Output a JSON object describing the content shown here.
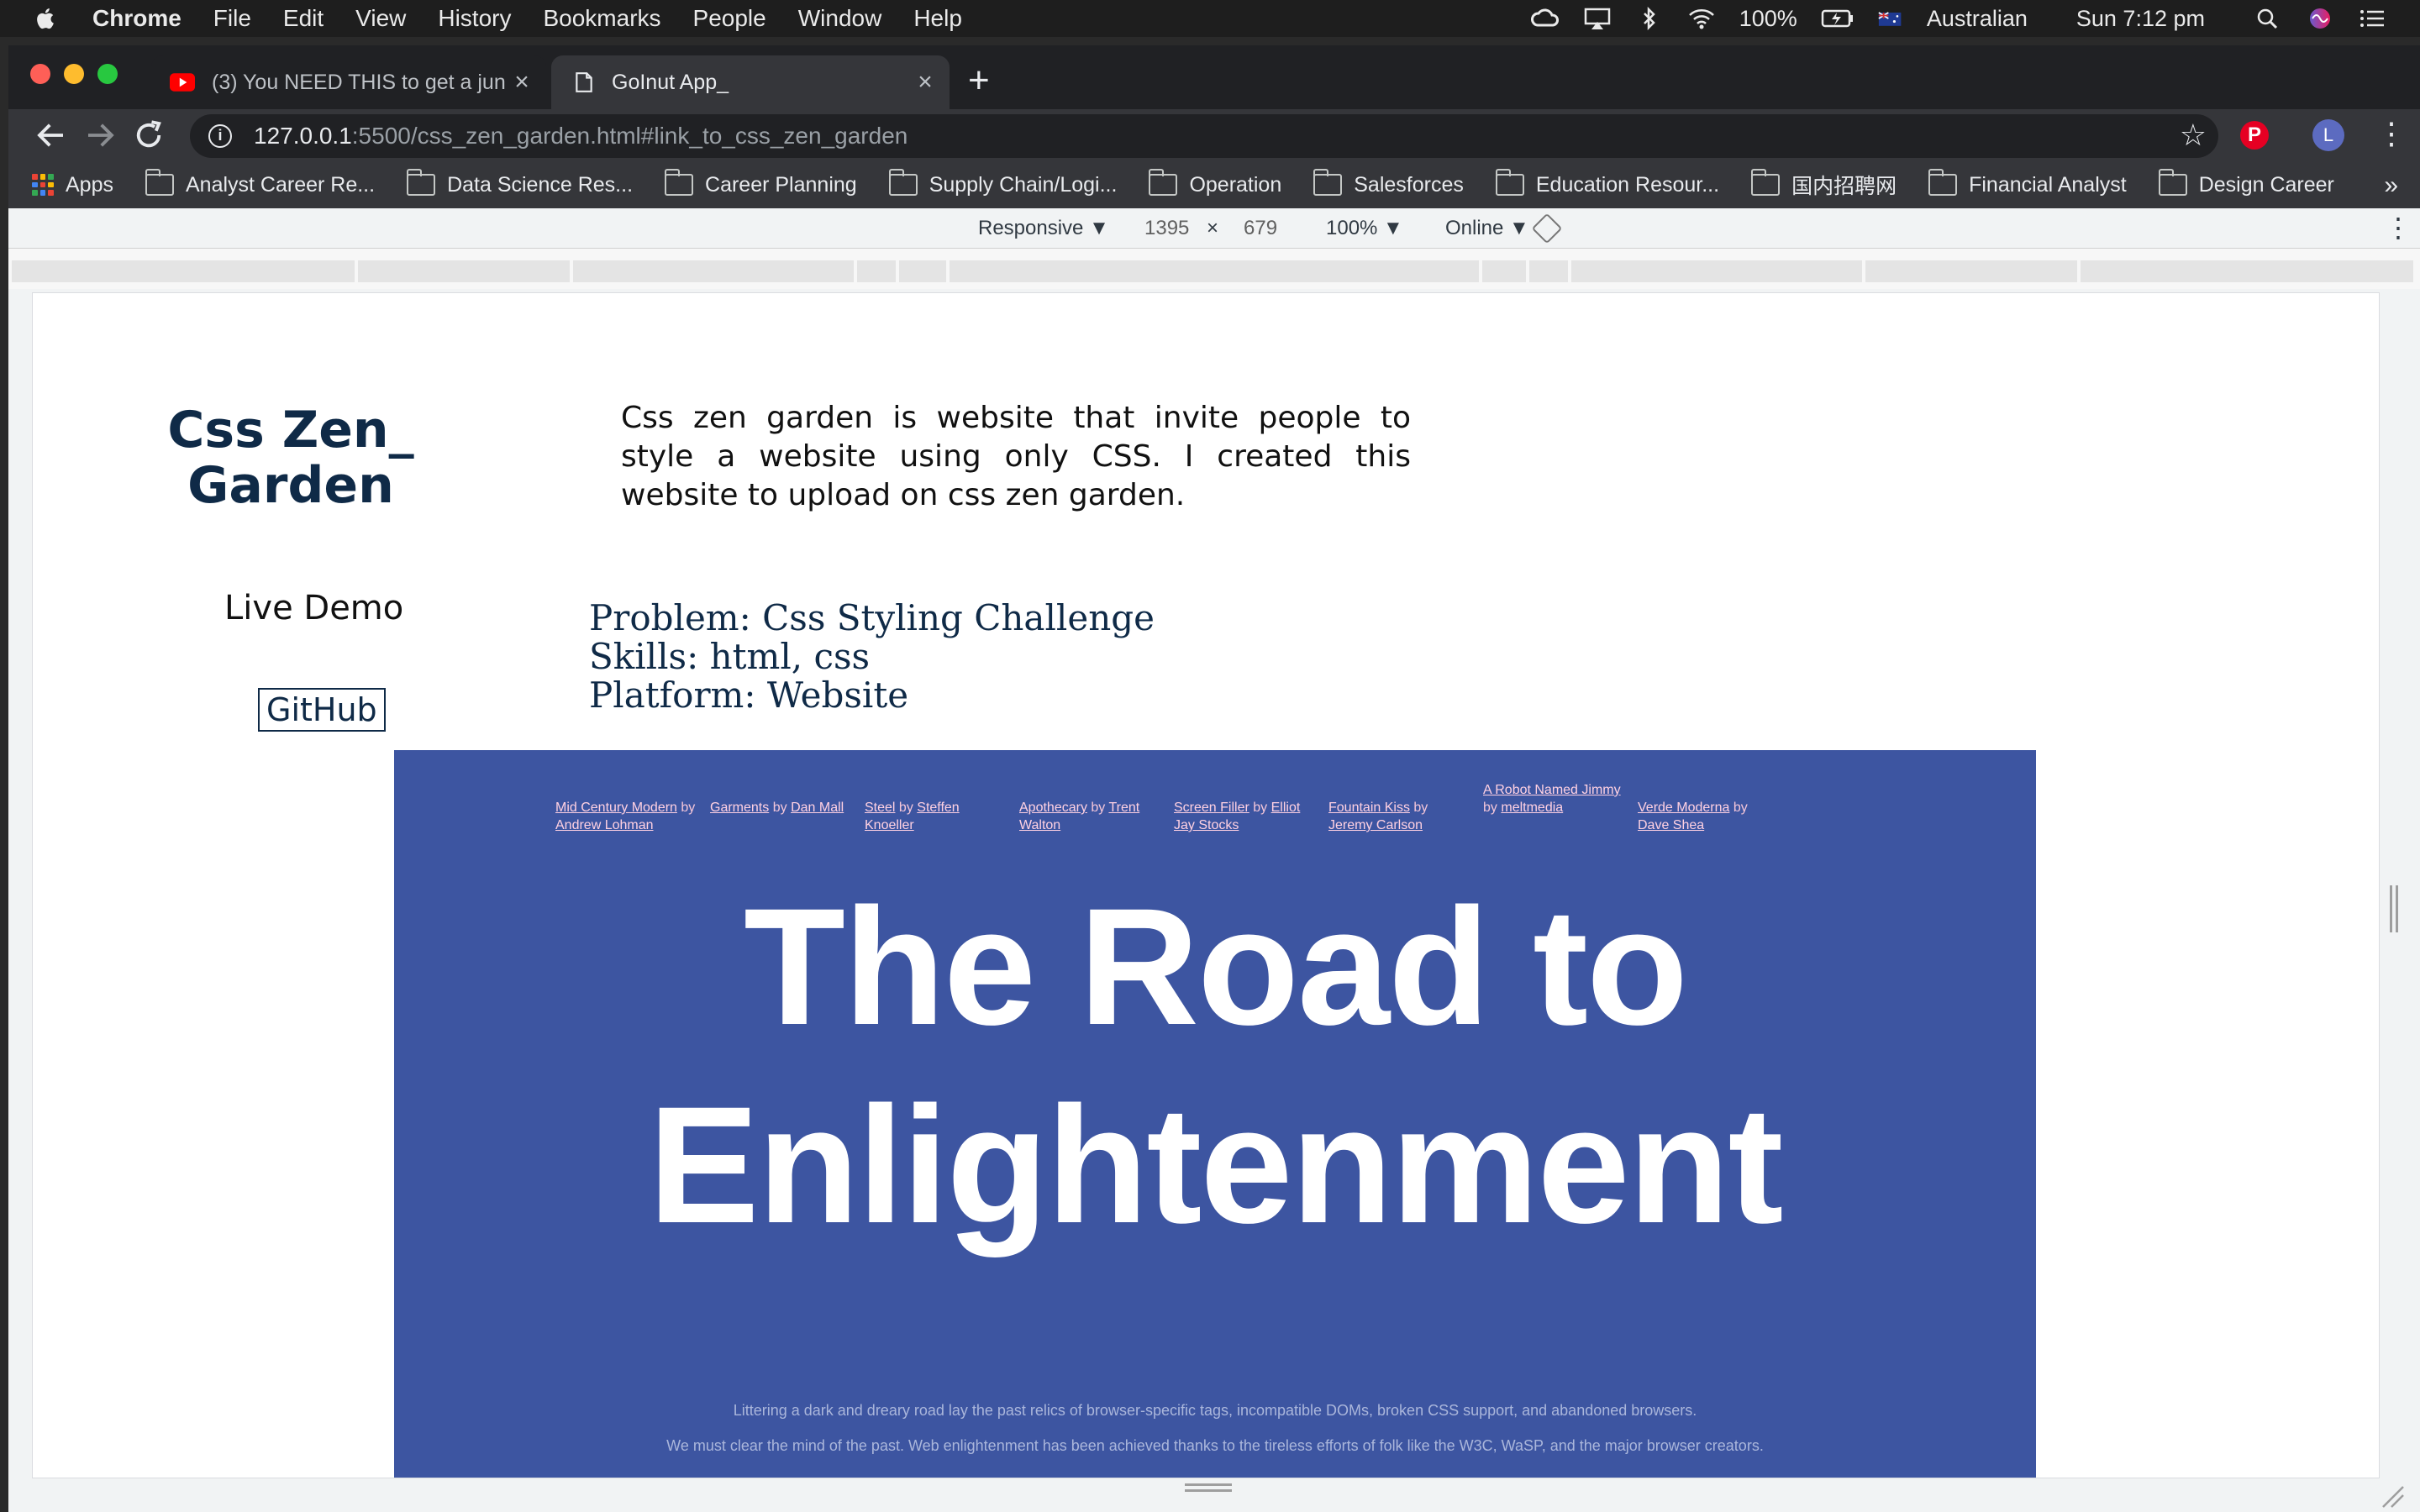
{
  "menubar": {
    "app": "Chrome",
    "items": [
      "File",
      "Edit",
      "View",
      "History",
      "Bookmarks",
      "People",
      "Window",
      "Help"
    ],
    "battery": "100%",
    "input_source": "Australian",
    "clock": "Sun 7:12 pm"
  },
  "tabs": [
    {
      "title": "(3) You NEED THIS to get a jun",
      "favicon": "youtube-icon",
      "active": false
    },
    {
      "title": "GoInut App_",
      "favicon": "page-icon",
      "active": true
    }
  ],
  "omnibox": {
    "host": "127.0.0.1",
    "rest": ":5500/css_zen_garden.html#link_to_css_zen_garden"
  },
  "profile_initial": "L",
  "bookmarks": {
    "apps_label": "Apps",
    "items": [
      "Analyst Career Re...",
      "Data Science Res...",
      "Career Planning",
      "Supply Chain/Logi...",
      "Operation",
      "Salesforces",
      "Education Resour...",
      "国内招聘网",
      "Financial Analyst",
      "Design Career"
    ],
    "more": "»"
  },
  "device_toolbar": {
    "device": "Responsive ▼",
    "width": "1395",
    "times": "×",
    "height": "679",
    "zoom": "100% ▼",
    "network": "Online ▼"
  },
  "page": {
    "logo_line1": "Css Zen_",
    "logo_line2": "Garden",
    "description": "Css zen garden is website that invite people to style a website using only CSS. I created this website to upload on css zen garden.",
    "live_demo": "Live Demo",
    "github": "GitHub",
    "problem": "Problem: Css Styling Challenge",
    "skills": "Skills: html, css",
    "platform": "Platform: Website",
    "dashes": "-------------"
  },
  "preview": {
    "design_links": [
      {
        "name": "Mid Century Modern",
        "author": "Andrew Lohman"
      },
      {
        "name": "Garments",
        "author": "Dan Mall"
      },
      {
        "name": "Steel",
        "author": "Steffen Knoeller"
      },
      {
        "name": "Apothecary",
        "author": "Trent Walton"
      },
      {
        "name": "Screen Filler",
        "author": "Elliot Jay Stocks"
      },
      {
        "name": "Fountain Kiss",
        "author": "Jeremy Carlson"
      },
      {
        "name": "A Robot Named Jimmy",
        "author": "meltmedia"
      },
      {
        "name": "Verde Moderna",
        "author": "Dave Shea"
      }
    ],
    "by": "by",
    "title_line1": "The Road to",
    "title_line2": "Enlightenment",
    "para1": "Littering a dark and dreary road lay the past relics of browser-specific tags, incompatible DOMs, broken CSS support, and abandoned browsers.",
    "para2": "We must clear the mind of the past. Web enlightenment has been achieved thanks to the tireless efforts of folk like the W3C, WaSP, and the major browser creators."
  },
  "colors": {
    "page_title": "#0f2a47",
    "preview_bg": "#3d55a1",
    "link_pink": "#ffd1e2"
  }
}
